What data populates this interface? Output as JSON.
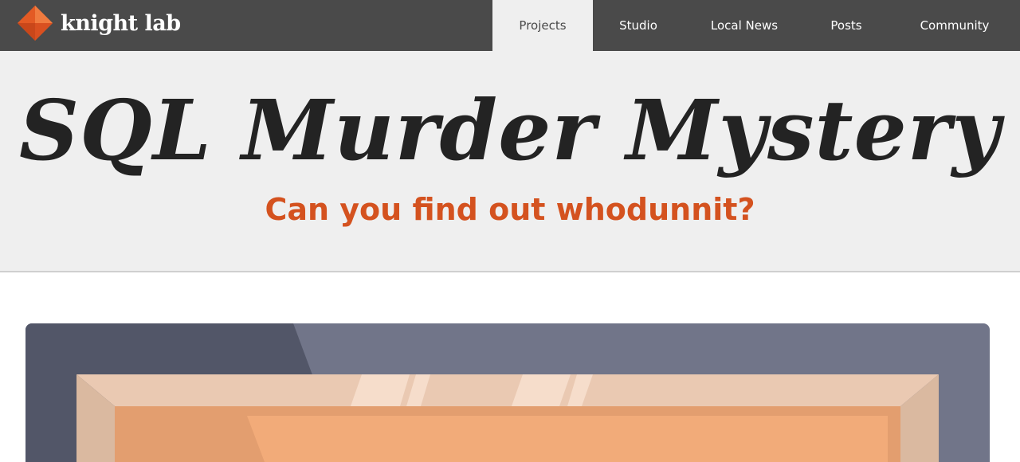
{
  "header": {
    "logo_text": "knight lab",
    "logo_icon": "diamond-logo-icon",
    "nav": [
      {
        "label": "Projects",
        "active": true
      },
      {
        "label": "Studio",
        "active": false
      },
      {
        "label": "Local News",
        "active": false
      },
      {
        "label": "Posts",
        "active": false
      },
      {
        "label": "Community",
        "active": false
      }
    ]
  },
  "hero": {
    "title": "SQL Murder Mystery",
    "subtitle": "Can you find out whodunnit?"
  },
  "colors": {
    "topbar": "#4a4a4a",
    "hero_bg": "#efefef",
    "title": "#232323",
    "subtitle": "#d4521f",
    "logo_orange": "#e35a24"
  }
}
